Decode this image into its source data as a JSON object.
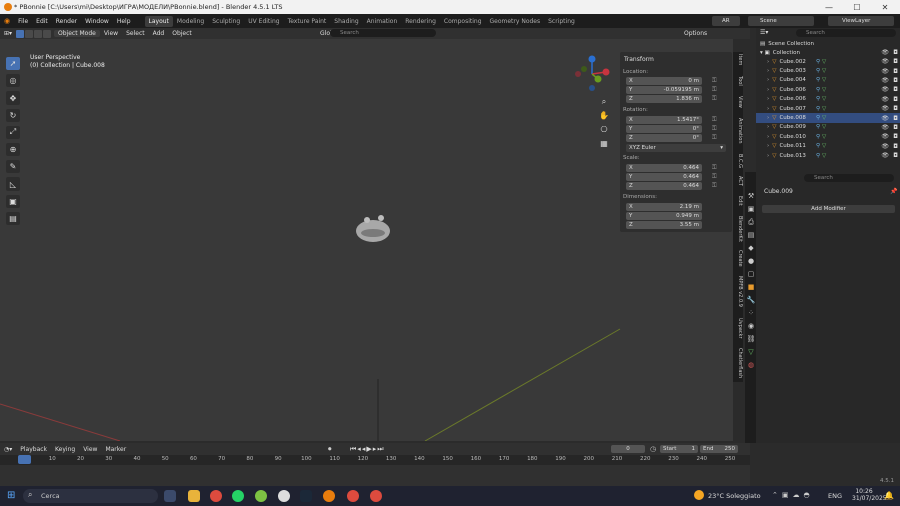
{
  "window": {
    "title": "* PBonnie [C:\\Users\\mi\\Desktop\\ИГРА\\МОДЕЛИ\\PBonnie.blend] - Blender 4.5.1 LTS",
    "minimize": "—",
    "maximize": "☐",
    "close": "✕"
  },
  "menu": {
    "items": [
      "File",
      "Edit",
      "Render",
      "Window",
      "Help"
    ]
  },
  "workspaces": [
    "Layout",
    "Modeling",
    "Sculpting",
    "UV Editing",
    "Texture Paint",
    "Shading",
    "Animation",
    "Rendering",
    "Compositing",
    "Geometry Nodes",
    "Scripting"
  ],
  "topright": {
    "scene": "Scene",
    "viewlayer": "ViewLayer",
    "render_engine": "AR"
  },
  "header": {
    "mode": "Object Mode",
    "view": "View",
    "select": "Select",
    "add": "Add",
    "object": "Object",
    "transform": "Global",
    "search_placeholder": "Search",
    "options": "Options"
  },
  "viewport": {
    "perspective": "User Perspective",
    "collection": "(0) Collection | Cube.008"
  },
  "npanel": {
    "title": "Transform",
    "location_label": "Location:",
    "location": [
      {
        "axis": "X",
        "value": "0 m"
      },
      {
        "axis": "Y",
        "value": "-0.059195 m"
      },
      {
        "axis": "Z",
        "value": "1.836 m"
      }
    ],
    "rotation_label": "Rotation:",
    "rotation": [
      {
        "axis": "X",
        "value": "1.5417°"
      },
      {
        "axis": "Y",
        "value": "0°"
      },
      {
        "axis": "Z",
        "value": "0°"
      }
    ],
    "rotation_mode": "XYZ Euler",
    "scale_label": "Scale:",
    "scale": [
      {
        "axis": "X",
        "value": "0.464"
      },
      {
        "axis": "Y",
        "value": "0.464"
      },
      {
        "axis": "Z",
        "value": "0.464"
      }
    ],
    "dimensions_label": "Dimensions:",
    "dimensions": [
      {
        "axis": "X",
        "value": "2.19 m"
      },
      {
        "axis": "Y",
        "value": "0.949 m"
      },
      {
        "axis": "Z",
        "value": "3.55 m"
      }
    ]
  },
  "sidetabs": [
    "Item",
    "Tool",
    "View",
    "Animation",
    "B.C.G",
    "ACT",
    "Edit",
    "BlenderKit",
    "Create",
    "MPFB v2.0.9",
    "Uvpackr",
    "Chatlerflash"
  ],
  "outliner": {
    "search_placeholder": "Search",
    "scene_collection": "Scene Collection",
    "collection": "Collection",
    "items": [
      "Cube.002",
      "Cube.003",
      "Cube.004",
      "Cube.006",
      "Cube.006",
      "Cube.007",
      "Cube.008",
      "Cube.009",
      "Cube.010",
      "Cube.011",
      "Cube.013"
    ],
    "selected_index": 6
  },
  "properties": {
    "search_placeholder": "Search",
    "object_name": "Cube.009",
    "add_modifier": "Add Modifier"
  },
  "timeline": {
    "menus": [
      "Playback",
      "Keying",
      "View",
      "Marker"
    ],
    "current_frame": "0",
    "start_label": "Start",
    "start": "1",
    "end_label": "End",
    "end": "250",
    "ticks": [
      "0",
      "10",
      "20",
      "30",
      "40",
      "50",
      "60",
      "70",
      "80",
      "90",
      "100",
      "110",
      "120",
      "130",
      "140",
      "150",
      "160",
      "170",
      "180",
      "190",
      "200",
      "210",
      "220",
      "230",
      "240",
      "250"
    ],
    "version": "4.5.1"
  },
  "taskbar": {
    "search_placeholder": "Cerca",
    "weather": "23°C Soleggiato",
    "lang": "ENG",
    "time": "10:26",
    "date": "31/07/2025"
  }
}
